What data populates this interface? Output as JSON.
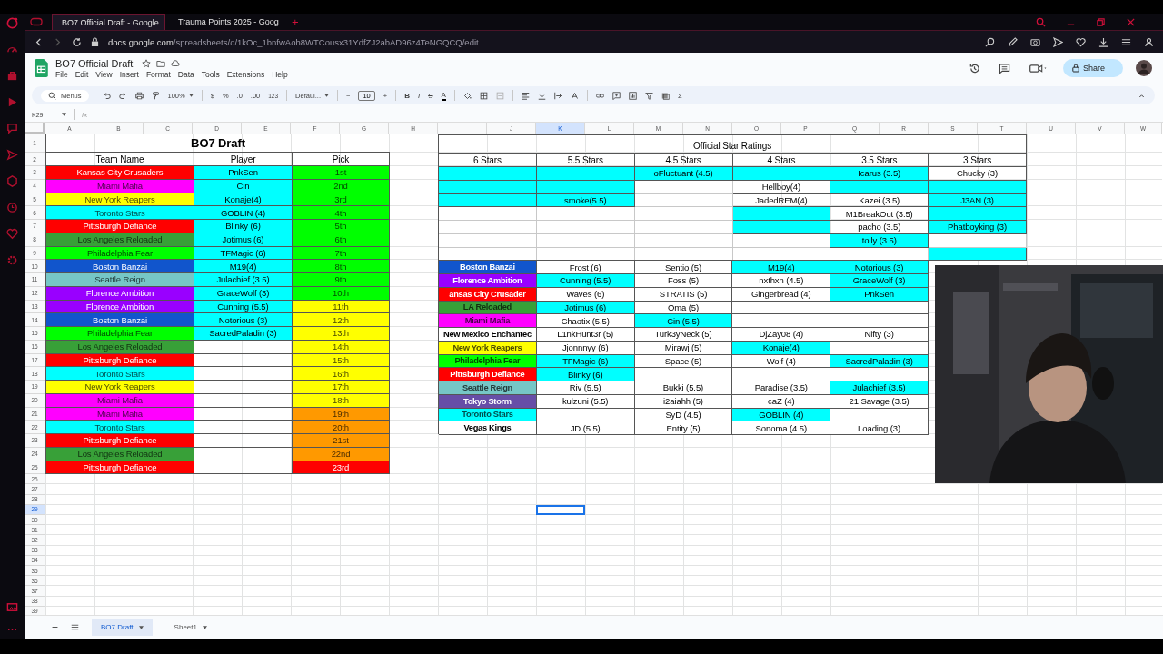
{
  "browser": {
    "tabs": [
      {
        "title": "BO7 Official Draft - Google",
        "selected": true
      },
      {
        "title": "Trauma Points 2025 - Goog",
        "selected": false
      }
    ],
    "new_tab": "+",
    "url_host": "docs.google.com",
    "url_path": "/spreadsheets/d/1kOc_1bnfwAoh8WTCousx31YdfZJ2abAD96z4TeNGQCQ/edit"
  },
  "sheets": {
    "title": "BO7 Official Draft",
    "menus": [
      "File",
      "Edit",
      "View",
      "Insert",
      "Format",
      "Data",
      "Tools",
      "Extensions",
      "Help"
    ],
    "share": "Share"
  },
  "toolbar": {
    "search": "Menus",
    "zoom": "100%",
    "currency": "$",
    "percent": "%",
    "decrease_decimals": ".0",
    "increase_decimals": ".00",
    "number_format": "123",
    "font": "Defaul...",
    "font_size_decrease": "−",
    "font_size": "10",
    "font_size_increase": "+",
    "bold": "B",
    "italic": "I",
    "strikethrough": "S",
    "text_color": "A",
    "functions": "Σ"
  },
  "formula_bar": {
    "cell": "K29",
    "fx": "fx"
  },
  "columns": [
    {
      "label": "A",
      "selected": false
    },
    {
      "label": "B",
      "selected": false
    },
    {
      "label": "C",
      "selected": false
    },
    {
      "label": "D",
      "selected": false
    },
    {
      "label": "E",
      "selected": false
    },
    {
      "label": "F",
      "selected": false
    },
    {
      "label": "G",
      "selected": false
    },
    {
      "label": "H",
      "selected": false
    },
    {
      "label": "I",
      "selected": false
    },
    {
      "label": "J",
      "selected": false
    },
    {
      "label": "K",
      "selected": true
    },
    {
      "label": "L",
      "selected": false
    },
    {
      "label": "M",
      "selected": false
    },
    {
      "label": "N",
      "selected": false
    },
    {
      "label": "O",
      "selected": false
    },
    {
      "label": "P",
      "selected": false
    },
    {
      "label": "Q",
      "selected": false
    },
    {
      "label": "R",
      "selected": false
    },
    {
      "label": "S",
      "selected": false
    },
    {
      "label": "T",
      "selected": false
    },
    {
      "label": "U",
      "selected": false
    },
    {
      "label": "V",
      "selected": false
    },
    {
      "label": "W",
      "selected": false
    }
  ],
  "rows": [
    {
      "label": "1",
      "selected": false
    },
    {
      "label": "2",
      "selected": false
    },
    {
      "label": "3",
      "selected": false
    },
    {
      "label": "4",
      "selected": false
    },
    {
      "label": "5",
      "selected": false
    },
    {
      "label": "6",
      "selected": false
    },
    {
      "label": "7",
      "selected": false
    },
    {
      "label": "8",
      "selected": false
    },
    {
      "label": "9",
      "selected": false
    },
    {
      "label": "10",
      "selected": false
    },
    {
      "label": "11",
      "selected": false
    },
    {
      "label": "12",
      "selected": false
    },
    {
      "label": "13",
      "selected": false
    },
    {
      "label": "14",
      "selected": false
    },
    {
      "label": "15",
      "selected": false
    },
    {
      "label": "16",
      "selected": false
    },
    {
      "label": "17",
      "selected": false
    },
    {
      "label": "18",
      "selected": false
    },
    {
      "label": "19",
      "selected": false
    },
    {
      "label": "20",
      "selected": false
    },
    {
      "label": "21",
      "selected": false
    },
    {
      "label": "22",
      "selected": false
    },
    {
      "label": "23",
      "selected": false
    },
    {
      "label": "24",
      "selected": false
    },
    {
      "label": "25",
      "selected": false
    },
    {
      "label": "26",
      "selected": false
    },
    {
      "label": "27",
      "selected": false
    },
    {
      "label": "28",
      "selected": false
    },
    {
      "label": "29",
      "selected": true
    },
    {
      "label": "30",
      "selected": false
    },
    {
      "label": "31",
      "selected": false
    },
    {
      "label": "32",
      "selected": false
    },
    {
      "label": "33",
      "selected": false
    },
    {
      "label": "34",
      "selected": false
    },
    {
      "label": "35",
      "selected": false
    },
    {
      "label": "36",
      "selected": false
    },
    {
      "label": "37",
      "selected": false
    },
    {
      "label": "38",
      "selected": false
    },
    {
      "label": "39",
      "selected": false
    }
  ],
  "draft": {
    "title": "BO7 Draft",
    "headers": [
      "Team Name",
      "Player",
      "Pick"
    ],
    "picks": [
      {
        "team": {
          "name": "Kansas City Crusaders",
          "color": "#ff0000"
        },
        "player": "PnkSen",
        "pick": {
          "label": "1st",
          "color": "#00ff00"
        }
      },
      {
        "team": {
          "name": "Miami Mafia",
          "color": "#ff00ff"
        },
        "player": "Cin",
        "pick": {
          "label": "2nd",
          "color": "#00ff00"
        }
      },
      {
        "team": {
          "name": "New York Reapers",
          "color": "#ffff00"
        },
        "player": "Konaje(4)",
        "pick": {
          "label": "3rd",
          "color": "#00ff00"
        }
      },
      {
        "team": {
          "name": "Toronto Stars",
          "color": "#00ffff"
        },
        "player": "GOBLIN (4)",
        "pick": {
          "label": "4th",
          "color": "#00ff00"
        }
      },
      {
        "team": {
          "name": "Pittsburgh Defiance",
          "color": "#ff0000"
        },
        "player": "Blinky (6)",
        "pick": {
          "label": "5th",
          "color": "#00ff00"
        }
      },
      {
        "team": {
          "name": "Los Angeles Reloaded",
          "color": "#38a038"
        },
        "player": "Jotimus (6)",
        "pick": {
          "label": "6th",
          "color": "#00ff00"
        }
      },
      {
        "team": {
          "name": "Philadelphia Fear",
          "color": "#00ff00"
        },
        "player": "TFMagic (6)",
        "pick": {
          "label": "7th",
          "color": "#00ff00"
        }
      },
      {
        "team": {
          "name": "Boston Banzai",
          "color": "#1155cc"
        },
        "player": "M19(4)",
        "pick": {
          "label": "8th",
          "color": "#00ff00"
        }
      },
      {
        "team": {
          "name": "Seattle Reign",
          "color": "#76c6c6"
        },
        "player": "Julachief (3.5)",
        "pick": {
          "label": "9th",
          "color": "#00ff00"
        }
      },
      {
        "team": {
          "name": "Florence Ambition",
          "color": "#9900ff"
        },
        "player": "GraceWolf (3)",
        "pick": {
          "label": "10th",
          "color": "#00ff00"
        }
      },
      {
        "team": {
          "name": "Florence Ambition",
          "color": "#9900ff"
        },
        "player": "Cunning (5.5)",
        "pick": {
          "label": "11th",
          "color": "#ffff00"
        }
      },
      {
        "team": {
          "name": "Boston Banzai",
          "color": "#1155cc"
        },
        "player": "Notorious (3)",
        "pick": {
          "label": "12th",
          "color": "#ffff00"
        }
      },
      {
        "team": {
          "name": "Philadelphia Fear",
          "color": "#00ff00"
        },
        "player": "SacredPaladin (3)",
        "pick": {
          "label": "13th",
          "color": "#ffff00"
        }
      },
      {
        "team": {
          "name": "Los Angeles Reloaded",
          "color": "#38a038"
        },
        "pick": {
          "label": "14th",
          "color": "#ffff00"
        }
      },
      {
        "team": {
          "name": "Pittsburgh Defiance",
          "color": "#ff0000"
        },
        "pick": {
          "label": "15th",
          "color": "#ffff00"
        }
      },
      {
        "team": {
          "name": "Toronto Stars",
          "color": "#00ffff"
        },
        "pick": {
          "label": "16th",
          "color": "#ffff00"
        }
      },
      {
        "team": {
          "name": "New York Reapers",
          "color": "#ffff00"
        },
        "pick": {
          "label": "17th",
          "color": "#ffff00"
        }
      },
      {
        "team": {
          "name": "Miami Mafia",
          "color": "#ff00ff"
        },
        "pick": {
          "label": "18th",
          "color": "#ffff00"
        }
      },
      {
        "team": {
          "name": "Miami Mafia",
          "color": "#ff00ff"
        },
        "pick": {
          "label": "19th",
          "color": "#ff9900"
        }
      },
      {
        "team": {
          "name": "Toronto Stars",
          "color": "#00ffff"
        },
        "pick": {
          "label": "20th",
          "color": "#ff9900"
        }
      },
      {
        "team": {
          "name": "Pittsburgh Defiance",
          "color": "#ff0000"
        },
        "pick": {
          "label": "21st",
          "color": "#ff9900"
        }
      },
      {
        "team": {
          "name": "Los Angeles Reloaded",
          "color": "#38a038"
        },
        "pick": {
          "label": "22nd",
          "color": "#ff9900"
        }
      },
      {
        "team": {
          "name": "Pittsburgh Defiance",
          "color": "#ff0000"
        },
        "pick": {
          "label": "23rd",
          "color": "#ff0000"
        }
      }
    ]
  },
  "ratings": {
    "title": "Official Star Ratings",
    "tiers": [
      "6 Stars",
      "5.5 Stars",
      "4.5 Stars",
      "4 Stars",
      "3.5 Stars",
      "3 Stars"
    ],
    "rows": [
      [
        {
          "highlighted": true
        },
        {
          "highlighted": true
        },
        {
          "text": "oFluctuant (4.5)",
          "highlighted": true
        },
        {
          "highlighted": true
        },
        {
          "text": "Icarus (3.5)",
          "highlighted": true
        },
        {
          "text": "Chucky (3)",
          "highlighted": false
        }
      ],
      [
        {
          "highlighted": true
        },
        {
          "highlighted": true
        },
        {
          "highlighted": false
        },
        {
          "text": "Hellboy(4)",
          "highlighted": false
        },
        {
          "highlighted": true
        },
        {
          "highlighted": true
        }
      ],
      [
        {
          "highlighted": true
        },
        {
          "text": "smoke(5.5)",
          "highlighted": true
        },
        {
          "highlighted": false
        },
        {
          "text": "JadedREM(4)",
          "highlighted": false
        },
        {
          "text": "Kazei (3.5)",
          "highlighted": false
        },
        {
          "text": "J3AN (3)",
          "highlighted": true
        }
      ],
      [
        {
          "highlighted": false
        },
        {
          "highlighted": false
        },
        {
          "highlighted": false
        },
        {
          "highlighted": true
        },
        {
          "text": "M1BreakOut (3.5)",
          "highlighted": false
        },
        {
          "highlighted": true
        }
      ],
      [
        {
          "highlighted": false
        },
        {
          "highlighted": false
        },
        {
          "highlighted": false
        },
        {
          "highlighted": true
        },
        {
          "text": "pacho (3.5)",
          "highlighted": false
        },
        {
          "text": "Phatboyking (3)",
          "highlighted": true
        }
      ],
      [
        {
          "highlighted": false
        },
        {
          "highlighted": false
        },
        {
          "highlighted": false
        },
        {
          "highlighted": false
        },
        {
          "text": "tolly (3.5)",
          "highlighted": true
        },
        {
          "highlighted": false
        }
      ],
      [
        {
          "highlighted": false
        },
        {
          "highlighted": false
        },
        {
          "highlighted": false
        },
        {
          "highlighted": false
        },
        {
          "highlighted": false
        },
        {
          "highlighted": true
        }
      ]
    ]
  },
  "rosters": [
    {
      "team": "Boston Banzai",
      "color": "#1155cc",
      "players": [
        {
          "name": "Frost (6)",
          "highlighted": false
        },
        {
          "name": "Sentio (5)",
          "highlighted": false
        },
        {
          "name": "M19(4)",
          "highlighted": true
        },
        {
          "name": "Notorious (3)",
          "highlighted": true
        }
      ]
    },
    {
      "team": "Florence Ambition",
      "color": "#9900ff",
      "players": [
        {
          "name": "Cunning (5.5)",
          "highlighted": true
        },
        {
          "name": "Foss (5)",
          "highlighted": false
        },
        {
          "name": "nxthxn (4.5)",
          "highlighted": false
        },
        {
          "name": "GraceWolf (3)",
          "highlighted": true
        }
      ]
    },
    {
      "team": "ansas City Crusader",
      "color": "#ff0000",
      "players": [
        {
          "name": "Waves (6)",
          "highlighted": false
        },
        {
          "name": "STRATIS (5)",
          "highlighted": false
        },
        {
          "name": "Gingerbread (4)",
          "highlighted": false
        },
        {
          "name": "PnkSen",
          "highlighted": true
        }
      ]
    },
    {
      "team": "LA Reloaded",
      "color": "#38a038",
      "players": [
        {
          "name": "Jotimus (6)",
          "highlighted": true
        },
        {
          "name": "Oma (5)",
          "highlighted": false
        },
        {
          "highlighted": false
        },
        {
          "highlighted": false
        }
      ]
    },
    {
      "team": "Miami Mafia",
      "color": "#ff00ff",
      "players": [
        {
          "name": "Chaotix (5.5)",
          "highlighted": false
        },
        {
          "name": "Cin (5.5)",
          "highlighted": true
        },
        {
          "highlighted": false
        },
        {
          "highlighted": false
        }
      ]
    },
    {
      "team": "New Mexico Enchantec",
      "color": "#ffffff",
      "players": [
        {
          "name": "L1nkHunt3r (5)",
          "highlighted": false
        },
        {
          "name": "Turk3yNeck (5)",
          "highlighted": false
        },
        {
          "name": "DjZay08 (4)",
          "highlighted": false
        },
        {
          "name": "Nifty (3)",
          "highlighted": false
        }
      ]
    },
    {
      "team": "New York Reapers",
      "color": "#ffff00",
      "players": [
        {
          "name": "Jjonnnyy (6)",
          "highlighted": false
        },
        {
          "name": "Mirawj (5)",
          "highlighted": false
        },
        {
          "name": "Konaje(4)",
          "highlighted": true
        },
        {
          "highlighted": false
        }
      ]
    },
    {
      "team": "Philadelphia Fear",
      "color": "#00ff00",
      "players": [
        {
          "name": "TFMagic (6)",
          "highlighted": true
        },
        {
          "name": "Space (5)",
          "highlighted": false
        },
        {
          "name": "Wolf (4)",
          "highlighted": false
        },
        {
          "name": "SacredPaladin (3)",
          "highlighted": true
        }
      ]
    },
    {
      "team": "Pittsburgh Defiance",
      "color": "#ff0000",
      "players": [
        {
          "name": "Blinky (6)",
          "highlighted": true
        },
        {
          "highlighted": false
        },
        {
          "highlighted": false
        },
        {
          "highlighted": false
        }
      ]
    },
    {
      "team": "Seattle Reign",
      "color": "#76c6c6",
      "players": [
        {
          "name": "Riv (5.5)",
          "highlighted": false
        },
        {
          "name": "Bukki (5.5)",
          "highlighted": false
        },
        {
          "name": "Paradise (3.5)",
          "highlighted": false
        },
        {
          "name": "Julachief (3.5)",
          "highlighted": true
        }
      ]
    },
    {
      "team": "Tokyo Storm",
      "color": "#674ea7",
      "players": [
        {
          "name": "kulzuni (5.5)",
          "highlighted": false
        },
        {
          "name": "i2aiahh (5)",
          "highlighted": false
        },
        {
          "name": "caZ (4)",
          "highlighted": false
        },
        {
          "name": "21 Savage (3.5)",
          "highlighted": false
        }
      ]
    },
    {
      "team": "Toronto Stars",
      "color": "#00ffff",
      "players": [
        {
          "highlighted": false
        },
        {
          "name": "SyD (4.5)",
          "highlighted": false
        },
        {
          "name": "GOBLIN (4)",
          "highlighted": true
        },
        {
          "highlighted": false
        }
      ]
    },
    {
      "team": "Vegas Kings",
      "color": "#ffffff",
      "players": [
        {
          "name": "JD (5.5)",
          "highlighted": false
        },
        {
          "name": "Entity (5)",
          "highlighted": false
        },
        {
          "name": "Sonoma (4.5)",
          "highlighted": false
        },
        {
          "name": "Loading (3)",
          "highlighted": false
        }
      ]
    }
  ],
  "add_sheet": "+",
  "sheet_tabs": [
    {
      "label": "BO7 Draft",
      "selected": true
    },
    {
      "label": "Sheet1",
      "selected": false
    }
  ]
}
